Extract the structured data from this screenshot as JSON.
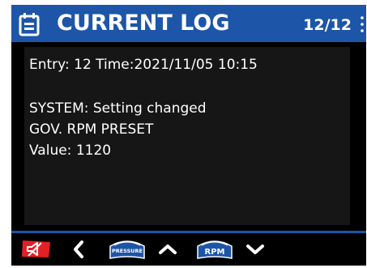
{
  "header": {
    "title": "CURRENT LOG",
    "counter": "12/12",
    "icon": "log-document-icon",
    "menu_icon": "kebab-menu-icon",
    "color": "#1d55a8"
  },
  "log": {
    "entry_line": "Entry: 12 Time:2021/11/05 10:15",
    "system_line": "SYSTEM: Setting changed",
    "detail_line": " GOV. RPM PRESET",
    "value_line": " Value: 1120"
  },
  "footer": {
    "mute_icon": "horn-mute-icon",
    "mute_color": "#e32026",
    "back_icon": "chevron-left-icon",
    "pressure_label": "PRESSURE",
    "up_icon": "chevron-up-icon",
    "rpm_label": "RPM",
    "down_icon": "chevron-down-icon",
    "badge_color": "#1d55a8"
  }
}
